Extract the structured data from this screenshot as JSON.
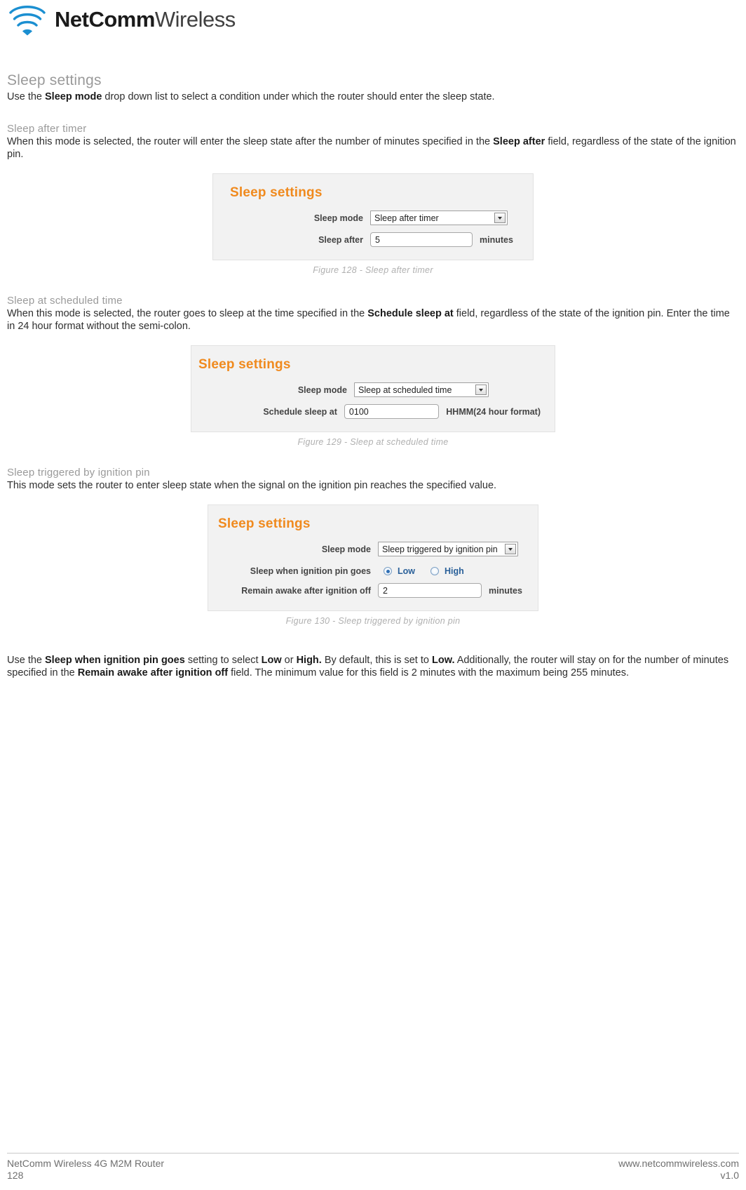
{
  "brand": {
    "name_bold": "NetComm",
    "name_light": "Wireless",
    "logo_icon": "wifi-signal-icon"
  },
  "content": {
    "section_title": "Sleep settings",
    "section_intro_pre": "Use the ",
    "section_intro_bold": "Sleep mode",
    "section_intro_post": " drop down list to select a condition under which the router should enter the sleep state.",
    "sub1": {
      "heading": "Sleep after timer",
      "text_pre": "When this mode is selected, the router will enter the sleep state after the number of minutes specified in the ",
      "text_bold": "Sleep after",
      "text_post": " field, regardless of the state of the ignition pin."
    },
    "sub2": {
      "heading": "Sleep at scheduled time",
      "text_pre": "When this mode is selected, the router goes to sleep at the time specified in the ",
      "text_bold": "Schedule sleep at",
      "text_post": " field, regardless of the state of the ignition pin. Enter the time in 24 hour format without the semi-colon."
    },
    "sub3": {
      "heading": "Sleep triggered by ignition pin",
      "text": "This mode sets the router to enter sleep state when the signal on the ignition pin reaches the specified value."
    },
    "closing": {
      "p1": "Use the ",
      "b1": "Sleep when ignition pin goes",
      "p2": " setting to select ",
      "b2": "Low",
      "p3": " or ",
      "b3": "High.",
      "p4": " By default, this is set to ",
      "b4": "Low.",
      "p5": " Additionally, the router will stay on for the number of minutes specified in the ",
      "b5": "Remain awake after ignition off",
      "p6": " field. The minimum value for this field is 2 minutes with the maximum being 255 minutes."
    }
  },
  "figures": [
    {
      "caption": "Figure 128 - Sleep after timer",
      "panel_title": "Sleep settings",
      "rows": [
        {
          "label": "Sleep mode",
          "control": "select",
          "value": "Sleep after timer",
          "suffix": ""
        },
        {
          "label": "Sleep after",
          "control": "text",
          "value": "5",
          "suffix": "minutes"
        }
      ]
    },
    {
      "caption": "Figure 129 - Sleep at scheduled time",
      "panel_title": "Sleep settings",
      "rows": [
        {
          "label": "Sleep mode",
          "control": "select",
          "value": "Sleep at scheduled time",
          "suffix": ""
        },
        {
          "label": "Schedule sleep at",
          "control": "text",
          "value": "0100",
          "suffix": "HHMM(24 hour format)"
        }
      ]
    },
    {
      "caption": "Figure 130 - Sleep triggered by ignition pin",
      "panel_title": "Sleep settings",
      "rows": [
        {
          "label": "Sleep mode",
          "control": "select",
          "value": "Sleep triggered by ignition pin",
          "suffix": ""
        },
        {
          "label": "Sleep when ignition pin goes",
          "control": "radio",
          "options": [
            "Low",
            "High"
          ],
          "selected": "Low",
          "suffix": ""
        },
        {
          "label": "Remain awake after ignition off",
          "control": "text",
          "value": "2",
          "suffix": "minutes"
        }
      ]
    }
  ],
  "footer": {
    "product": "NetComm Wireless 4G M2M Router",
    "page_number": "128",
    "website": "www.netcommwireless.com",
    "version": "v1.0"
  },
  "colors": {
    "accent_orange": "#f08a1e",
    "heading_grey": "#9a9a9a",
    "brand_blue": "#1b8fd1"
  }
}
